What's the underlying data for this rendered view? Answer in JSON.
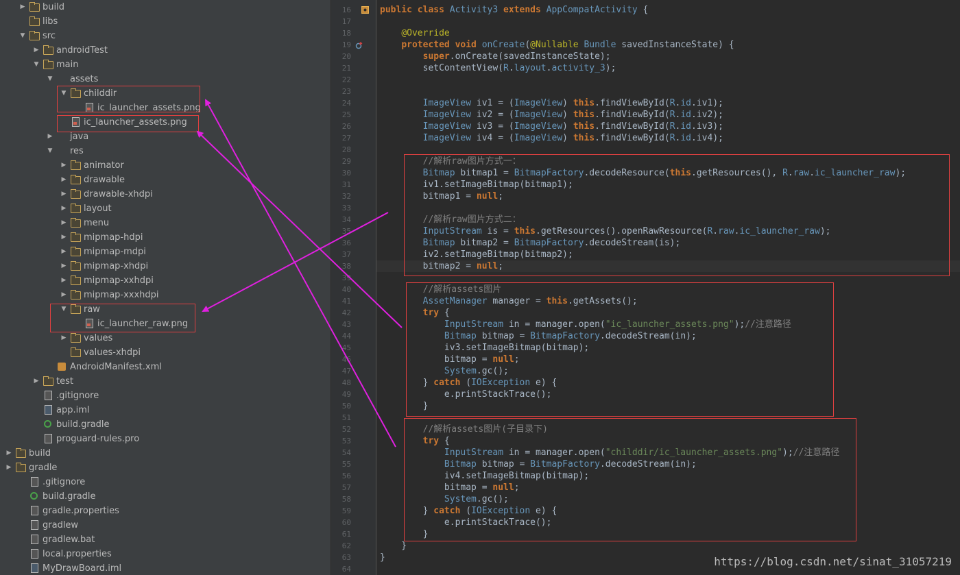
{
  "tree": [
    {
      "indent": 1,
      "arrow": "right",
      "icon": "folder",
      "label": "build"
    },
    {
      "indent": 1,
      "arrow": "",
      "icon": "folder",
      "label": "libs"
    },
    {
      "indent": 1,
      "arrow": "down",
      "icon": "folder",
      "label": "src"
    },
    {
      "indent": 2,
      "arrow": "right",
      "icon": "folder",
      "label": "androidTest"
    },
    {
      "indent": 2,
      "arrow": "down",
      "icon": "folder",
      "label": "main"
    },
    {
      "indent": 3,
      "arrow": "down",
      "icon": "folder-res",
      "label": "assets"
    },
    {
      "indent": 4,
      "arrow": "down",
      "icon": "folder",
      "label": "childdir"
    },
    {
      "indent": 5,
      "arrow": "",
      "icon": "img",
      "label": "ic_launcher_assets.png"
    },
    {
      "indent": 4,
      "arrow": "",
      "icon": "img",
      "label": "ic_launcher_assets.png"
    },
    {
      "indent": 3,
      "arrow": "right",
      "icon": "folder-blue",
      "label": "java"
    },
    {
      "indent": 3,
      "arrow": "down",
      "icon": "folder-res",
      "label": "res"
    },
    {
      "indent": 4,
      "arrow": "right",
      "icon": "folder",
      "label": "animator"
    },
    {
      "indent": 4,
      "arrow": "right",
      "icon": "folder",
      "label": "drawable"
    },
    {
      "indent": 4,
      "arrow": "right",
      "icon": "folder",
      "label": "drawable-xhdpi"
    },
    {
      "indent": 4,
      "arrow": "right",
      "icon": "folder",
      "label": "layout"
    },
    {
      "indent": 4,
      "arrow": "right",
      "icon": "folder",
      "label": "menu"
    },
    {
      "indent": 4,
      "arrow": "right",
      "icon": "folder",
      "label": "mipmap-hdpi"
    },
    {
      "indent": 4,
      "arrow": "right",
      "icon": "folder",
      "label": "mipmap-mdpi"
    },
    {
      "indent": 4,
      "arrow": "right",
      "icon": "folder",
      "label": "mipmap-xhdpi"
    },
    {
      "indent": 4,
      "arrow": "right",
      "icon": "folder",
      "label": "mipmap-xxhdpi"
    },
    {
      "indent": 4,
      "arrow": "right",
      "icon": "folder",
      "label": "mipmap-xxxhdpi"
    },
    {
      "indent": 4,
      "arrow": "down",
      "icon": "folder",
      "label": "raw"
    },
    {
      "indent": 5,
      "arrow": "",
      "icon": "img",
      "label": "ic_launcher_raw.png"
    },
    {
      "indent": 4,
      "arrow": "right",
      "icon": "folder",
      "label": "values"
    },
    {
      "indent": 4,
      "arrow": "",
      "icon": "folder",
      "label": "values-xhdpi"
    },
    {
      "indent": 3,
      "arrow": "",
      "icon": "xml",
      "label": "AndroidManifest.xml"
    },
    {
      "indent": 2,
      "arrow": "right",
      "icon": "folder",
      "label": "test"
    },
    {
      "indent": 2,
      "arrow": "",
      "icon": "file",
      "label": ".gitignore"
    },
    {
      "indent": 2,
      "arrow": "",
      "icon": "iml",
      "label": "app.iml"
    },
    {
      "indent": 2,
      "arrow": "",
      "icon": "gradle",
      "label": "build.gradle"
    },
    {
      "indent": 2,
      "arrow": "",
      "icon": "file",
      "label": "proguard-rules.pro"
    },
    {
      "indent": 0,
      "arrow": "right",
      "icon": "folder",
      "label": "build"
    },
    {
      "indent": 0,
      "arrow": "right",
      "icon": "folder",
      "label": "gradle"
    },
    {
      "indent": 1,
      "arrow": "",
      "icon": "file",
      "label": ".gitignore"
    },
    {
      "indent": 1,
      "arrow": "",
      "icon": "gradle",
      "label": "build.gradle"
    },
    {
      "indent": 1,
      "arrow": "",
      "icon": "file",
      "label": "gradle.properties"
    },
    {
      "indent": 1,
      "arrow": "",
      "icon": "file",
      "label": "gradlew"
    },
    {
      "indent": 1,
      "arrow": "",
      "icon": "file",
      "label": "gradlew.bat"
    },
    {
      "indent": 1,
      "arrow": "",
      "icon": "file",
      "label": "local.properties"
    },
    {
      "indent": 1,
      "arrow": "",
      "icon": "iml",
      "label": "MyDrawBoard.iml"
    }
  ],
  "code_lines": [
    {
      "n": "16",
      "t": [
        [
          "kw",
          "public class "
        ],
        [
          "ty",
          "Activity3 "
        ],
        [
          "kw",
          "extends "
        ],
        [
          "ty",
          "AppCompatActivity "
        ],
        [
          "plain",
          "{"
        ]
      ]
    },
    {
      "n": "17",
      "t": []
    },
    {
      "n": "18",
      "t": [
        [
          "plain",
          "    "
        ],
        [
          "ann",
          "@Override"
        ]
      ]
    },
    {
      "n": "19",
      "t": [
        [
          "plain",
          "    "
        ],
        [
          "kw",
          "protected void "
        ],
        [
          "ty",
          "onCreate"
        ],
        [
          "plain",
          "("
        ],
        [
          "ann",
          "@Nullable "
        ],
        [
          "ty",
          "Bundle "
        ],
        [
          "plain",
          "savedInstanceState) {"
        ]
      ]
    },
    {
      "n": "20",
      "t": [
        [
          "plain",
          "        "
        ],
        [
          "kw",
          "super"
        ],
        [
          "plain",
          ".onCreate(savedInstanceState);"
        ]
      ]
    },
    {
      "n": "21",
      "t": [
        [
          "plain",
          "        setContentView("
        ],
        [
          "ty",
          "R"
        ],
        [
          "plain",
          "."
        ],
        [
          "ty",
          "layout"
        ],
        [
          "plain",
          "."
        ],
        [
          "ty",
          "activity_3"
        ],
        [
          "plain",
          ");"
        ]
      ]
    },
    {
      "n": "22",
      "t": []
    },
    {
      "n": "23",
      "t": []
    },
    {
      "n": "24",
      "t": [
        [
          "plain",
          "        "
        ],
        [
          "ty",
          "ImageView "
        ],
        [
          "plain",
          "iv1 = ("
        ],
        [
          "ty",
          "ImageView"
        ],
        [
          "plain",
          ") "
        ],
        [
          "kw",
          "this"
        ],
        [
          "plain",
          ".findViewById("
        ],
        [
          "ty",
          "R"
        ],
        [
          "plain",
          "."
        ],
        [
          "ty",
          "id"
        ],
        [
          "plain",
          ".iv1);"
        ]
      ]
    },
    {
      "n": "25",
      "t": [
        [
          "plain",
          "        "
        ],
        [
          "ty",
          "ImageView "
        ],
        [
          "plain",
          "iv2 = ("
        ],
        [
          "ty",
          "ImageView"
        ],
        [
          "plain",
          ") "
        ],
        [
          "kw",
          "this"
        ],
        [
          "plain",
          ".findViewById("
        ],
        [
          "ty",
          "R"
        ],
        [
          "plain",
          "."
        ],
        [
          "ty",
          "id"
        ],
        [
          "plain",
          ".iv2);"
        ]
      ]
    },
    {
      "n": "26",
      "t": [
        [
          "plain",
          "        "
        ],
        [
          "ty",
          "ImageView "
        ],
        [
          "plain",
          "iv3 = ("
        ],
        [
          "ty",
          "ImageView"
        ],
        [
          "plain",
          ") "
        ],
        [
          "kw",
          "this"
        ],
        [
          "plain",
          ".findViewById("
        ],
        [
          "ty",
          "R"
        ],
        [
          "plain",
          "."
        ],
        [
          "ty",
          "id"
        ],
        [
          "plain",
          ".iv3);"
        ]
      ]
    },
    {
      "n": "27",
      "t": [
        [
          "plain",
          "        "
        ],
        [
          "ty",
          "ImageView "
        ],
        [
          "plain",
          "iv4 = ("
        ],
        [
          "ty",
          "ImageView"
        ],
        [
          "plain",
          ") "
        ],
        [
          "kw",
          "this"
        ],
        [
          "plain",
          ".findViewById("
        ],
        [
          "ty",
          "R"
        ],
        [
          "plain",
          "."
        ],
        [
          "ty",
          "id"
        ],
        [
          "plain",
          ".iv4);"
        ]
      ]
    },
    {
      "n": "28",
      "t": []
    },
    {
      "n": "29",
      "t": [
        [
          "plain",
          "        "
        ],
        [
          "cmt",
          "//解析raw图片方式一："
        ]
      ]
    },
    {
      "n": "30",
      "t": [
        [
          "plain",
          "        "
        ],
        [
          "ty",
          "Bitmap "
        ],
        [
          "plain",
          "bitmap1 = "
        ],
        [
          "ty",
          "BitmapFactory"
        ],
        [
          "plain",
          ".decodeResource("
        ],
        [
          "kw",
          "this"
        ],
        [
          "plain",
          ".getResources(), "
        ],
        [
          "ty",
          "R"
        ],
        [
          "plain",
          "."
        ],
        [
          "ty",
          "raw"
        ],
        [
          "plain",
          "."
        ],
        [
          "ty",
          "ic_launcher_raw"
        ],
        [
          "plain",
          ");"
        ]
      ]
    },
    {
      "n": "31",
      "t": [
        [
          "plain",
          "        iv1.setImageBitmap(bitmap1);"
        ]
      ]
    },
    {
      "n": "32",
      "t": [
        [
          "plain",
          "        bitmap1 = "
        ],
        [
          "kw",
          "null"
        ],
        [
          "plain",
          ";"
        ]
      ]
    },
    {
      "n": "33",
      "t": []
    },
    {
      "n": "34",
      "t": [
        [
          "plain",
          "        "
        ],
        [
          "cmt",
          "//解析raw图片方式二："
        ]
      ]
    },
    {
      "n": "35",
      "t": [
        [
          "plain",
          "        "
        ],
        [
          "ty",
          "InputStream "
        ],
        [
          "plain",
          "is = "
        ],
        [
          "kw",
          "this"
        ],
        [
          "plain",
          ".getResources().openRawResource("
        ],
        [
          "ty",
          "R"
        ],
        [
          "plain",
          "."
        ],
        [
          "ty",
          "raw"
        ],
        [
          "plain",
          "."
        ],
        [
          "ty",
          "ic_launcher_raw"
        ],
        [
          "plain",
          ");"
        ]
      ]
    },
    {
      "n": "36",
      "t": [
        [
          "plain",
          "        "
        ],
        [
          "ty",
          "Bitmap "
        ],
        [
          "plain",
          "bitmap2 = "
        ],
        [
          "ty",
          "BitmapFactory"
        ],
        [
          "plain",
          ".decodeStream(is);"
        ]
      ]
    },
    {
      "n": "37",
      "t": [
        [
          "plain",
          "        iv2.setImageBitmap(bitmap2);"
        ]
      ]
    },
    {
      "n": "38",
      "t": [
        [
          "plain",
          "        bitmap2 = "
        ],
        [
          "kw",
          "null"
        ],
        [
          "plain",
          ";"
        ]
      ]
    },
    {
      "n": "39",
      "t": []
    },
    {
      "n": "40",
      "t": [
        [
          "plain",
          "        "
        ],
        [
          "cmt",
          "//解析assets图片"
        ]
      ]
    },
    {
      "n": "41",
      "t": [
        [
          "plain",
          "        "
        ],
        [
          "ty",
          "AssetManager "
        ],
        [
          "plain",
          "manager = "
        ],
        [
          "kw",
          "this"
        ],
        [
          "plain",
          ".getAssets();"
        ]
      ]
    },
    {
      "n": "42",
      "t": [
        [
          "plain",
          "        "
        ],
        [
          "kw",
          "try "
        ],
        [
          "plain",
          "{"
        ]
      ]
    },
    {
      "n": "43",
      "t": [
        [
          "plain",
          "            "
        ],
        [
          "ty",
          "InputStream "
        ],
        [
          "plain",
          "in = manager.open("
        ],
        [
          "str",
          "\"ic_launcher_assets.png\""
        ],
        [
          "plain",
          ");"
        ],
        [
          "cmt",
          "//注意路径"
        ]
      ]
    },
    {
      "n": "44",
      "t": [
        [
          "plain",
          "            "
        ],
        [
          "ty",
          "Bitmap "
        ],
        [
          "plain",
          "bitmap = "
        ],
        [
          "ty",
          "BitmapFactory"
        ],
        [
          "plain",
          ".decodeStream(in);"
        ]
      ]
    },
    {
      "n": "45",
      "t": [
        [
          "plain",
          "            iv3.setImageBitmap(bitmap);"
        ]
      ]
    },
    {
      "n": "46",
      "t": [
        [
          "plain",
          "            bitmap = "
        ],
        [
          "kw",
          "null"
        ],
        [
          "plain",
          ";"
        ]
      ]
    },
    {
      "n": "47",
      "t": [
        [
          "plain",
          "            "
        ],
        [
          "ty",
          "System"
        ],
        [
          "plain",
          ".gc();"
        ]
      ]
    },
    {
      "n": "48",
      "t": [
        [
          "plain",
          "        } "
        ],
        [
          "kw",
          "catch "
        ],
        [
          "plain",
          "("
        ],
        [
          "ty",
          "IOException "
        ],
        [
          "plain",
          "e) {"
        ]
      ]
    },
    {
      "n": "49",
      "t": [
        [
          "plain",
          "            e.printStackTrace();"
        ]
      ]
    },
    {
      "n": "50",
      "t": [
        [
          "plain",
          "        }"
        ]
      ]
    },
    {
      "n": "51",
      "t": []
    },
    {
      "n": "52",
      "t": [
        [
          "plain",
          "        "
        ],
        [
          "cmt",
          "//解析assets图片(子目录下)"
        ]
      ]
    },
    {
      "n": "53",
      "t": [
        [
          "plain",
          "        "
        ],
        [
          "kw",
          "try "
        ],
        [
          "plain",
          "{"
        ]
      ]
    },
    {
      "n": "54",
      "t": [
        [
          "plain",
          "            "
        ],
        [
          "ty",
          "InputStream "
        ],
        [
          "plain",
          "in = manager.open("
        ],
        [
          "str",
          "\"childdir/ic_launcher_assets.png\""
        ],
        [
          "plain",
          ");"
        ],
        [
          "cmt",
          "//注意路径"
        ]
      ]
    },
    {
      "n": "55",
      "t": [
        [
          "plain",
          "            "
        ],
        [
          "ty",
          "Bitmap "
        ],
        [
          "plain",
          "bitmap = "
        ],
        [
          "ty",
          "BitmapFactory"
        ],
        [
          "plain",
          ".decodeStream(in);"
        ]
      ]
    },
    {
      "n": "56",
      "t": [
        [
          "plain",
          "            iv4.setImageBitmap(bitmap);"
        ]
      ]
    },
    {
      "n": "57",
      "t": [
        [
          "plain",
          "            bitmap = "
        ],
        [
          "kw",
          "null"
        ],
        [
          "plain",
          ";"
        ]
      ]
    },
    {
      "n": "58",
      "t": [
        [
          "plain",
          "            "
        ],
        [
          "ty",
          "System"
        ],
        [
          "plain",
          ".gc();"
        ]
      ]
    },
    {
      "n": "59",
      "t": [
        [
          "plain",
          "        } "
        ],
        [
          "kw",
          "catch "
        ],
        [
          "plain",
          "("
        ],
        [
          "ty",
          "IOException "
        ],
        [
          "plain",
          "e) {"
        ]
      ]
    },
    {
      "n": "60",
      "t": [
        [
          "plain",
          "            e.printStackTrace();"
        ]
      ]
    },
    {
      "n": "61",
      "t": [
        [
          "plain",
          "        }"
        ]
      ]
    },
    {
      "n": "62",
      "t": [
        [
          "plain",
          "    }"
        ]
      ]
    },
    {
      "n": "63",
      "t": [
        [
          "plain",
          "}"
        ]
      ]
    },
    {
      "n": "64",
      "t": []
    }
  ],
  "current_line": "38",
  "watermark": "https://blog.csdn.net/sinat_31057219",
  "colors": {
    "annotation_box": "#e04040",
    "arrow": "#e020e0"
  }
}
